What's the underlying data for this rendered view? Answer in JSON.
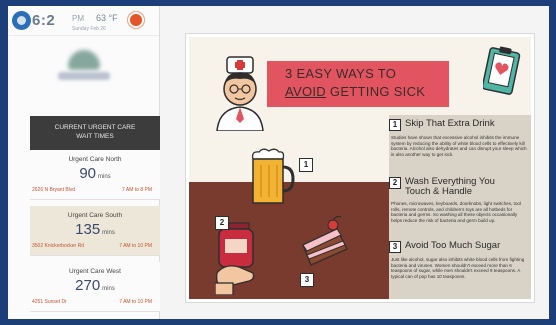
{
  "header": {
    "clock": "6:2",
    "ampm": "PM",
    "temperature": "63 °F",
    "date": "Sunday Feb 26"
  },
  "wait_times": {
    "title_line1": "CURRENT URGENT CARE",
    "title_line2": "WAIT TIMES",
    "clinics": [
      {
        "name": "Urgent Care North",
        "minutes": "90",
        "unit": "mins",
        "address": "2626 N Bryant Blvd",
        "hours": "7 AM to 8 PM"
      },
      {
        "name": "Urgent Care South",
        "minutes": "135",
        "unit": "mins",
        "address": "3502 Knickerbocker Rd",
        "hours": "7 AM to 10 PM"
      },
      {
        "name": "Urgent Care West",
        "minutes": "270",
        "unit": "mins",
        "address": "4251 Sunset Dr",
        "hours": "7 AM to 10 PM"
      }
    ]
  },
  "poster": {
    "title_line1": "3 EASY WAYS TO",
    "title_avoid": "AVOID",
    "title_line2_rest": " GETTING SICK",
    "tips": [
      {
        "num": "1",
        "heading": "Skip That Extra Drink",
        "body": "Studies have shown that excessive alcohol inhibits the immune system by reducing the ability of white blood cells to effectively kill bacteria. Alcohol also dehydrates and can disrupt your sleep which is also another way to get sick."
      },
      {
        "num": "2",
        "heading": "Wash Everything You Touch & Handle",
        "body": "Phones, microwaves, keyboards, doorknobs, light switches, tool rolls, remote controls, and children's toys are all hotbeds for bacteria and germs. So washing all these objects occasionally helps reduce the risk of bacteria and germ build up."
      },
      {
        "num": "3",
        "heading": "Avoid Too Much Sugar",
        "body": "Just like alcohol, sugar also inhibits white blood cells from fighting bacteria and viruses. Women shouldn't exceed more than 6 teaspoons of sugar, while men shouldn't exceed 9 teaspoons. A typical can of pop has 10 teaspoons."
      }
    ],
    "badges": [
      "1",
      "2",
      "3"
    ]
  },
  "colors": {
    "frame": "#1c3f7a",
    "poster_band": "#e2545f",
    "poster_brown": "#7a3b2f",
    "address_text": "#c6532f"
  }
}
